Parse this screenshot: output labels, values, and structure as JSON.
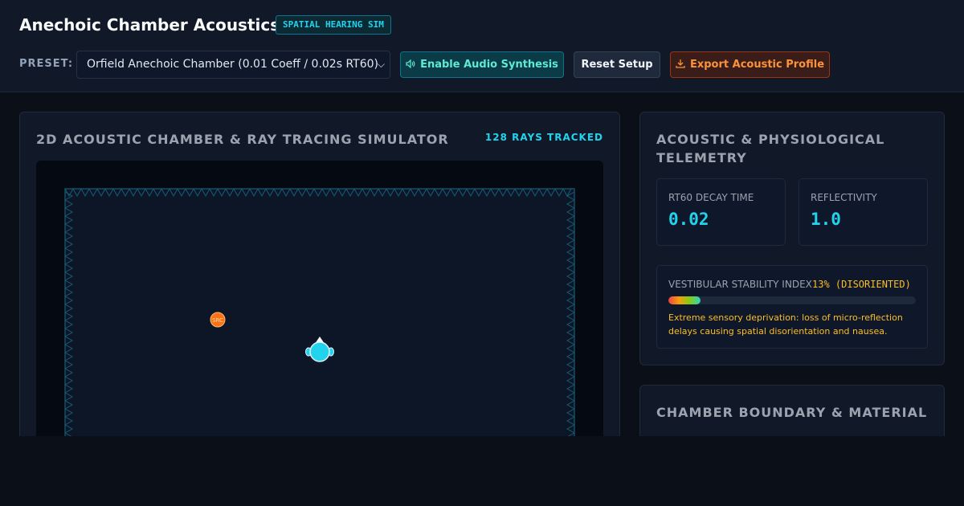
{
  "header": {
    "title": "Anechoic Chamber Acoustics",
    "badge": "SPATIAL HEARING SIM",
    "preset_label": "PRESET:",
    "preset_value": "Orfield Anechoic Chamber (0.01 Coeff / 0.02s RT60)",
    "buttons": {
      "audio": "Enable Audio Synthesis",
      "reset": "Reset Setup",
      "export": "Export Acoustic Profile"
    }
  },
  "simulator": {
    "title": "2D ACOUSTIC CHAMBER & RAY TRACING SIMULATOR",
    "rays_tracked": "128 RAYS TRACKED",
    "source_label": "SRC"
  },
  "telemetry": {
    "title": "ACOUSTIC & PHYSIOLOGICAL TELEMETRY",
    "rt60_label": "RT60 DECAY TIME",
    "rt60_value": "0.02",
    "reflectivity_label": "REFLECTIVITY",
    "reflectivity_value": "1.0",
    "vestibular_label": "VESTIBULAR STABILITY INDEX",
    "vestibular_status": "13% (DISORIENTED)",
    "vestibular_percent": 13,
    "vestibular_note": "Extreme sensory deprivation: loss of micro-reflection delays causing spatial disorientation and nausea."
  },
  "boundary": {
    "title": "CHAMBER BOUNDARY & MATERIAL"
  },
  "colors": {
    "accent": "#22d3ee",
    "warning": "#fbbf24",
    "export": "#fb923c"
  },
  "icons": {
    "audio": "speaker-icon",
    "export": "download-icon",
    "select": "chevron-down-icon"
  }
}
